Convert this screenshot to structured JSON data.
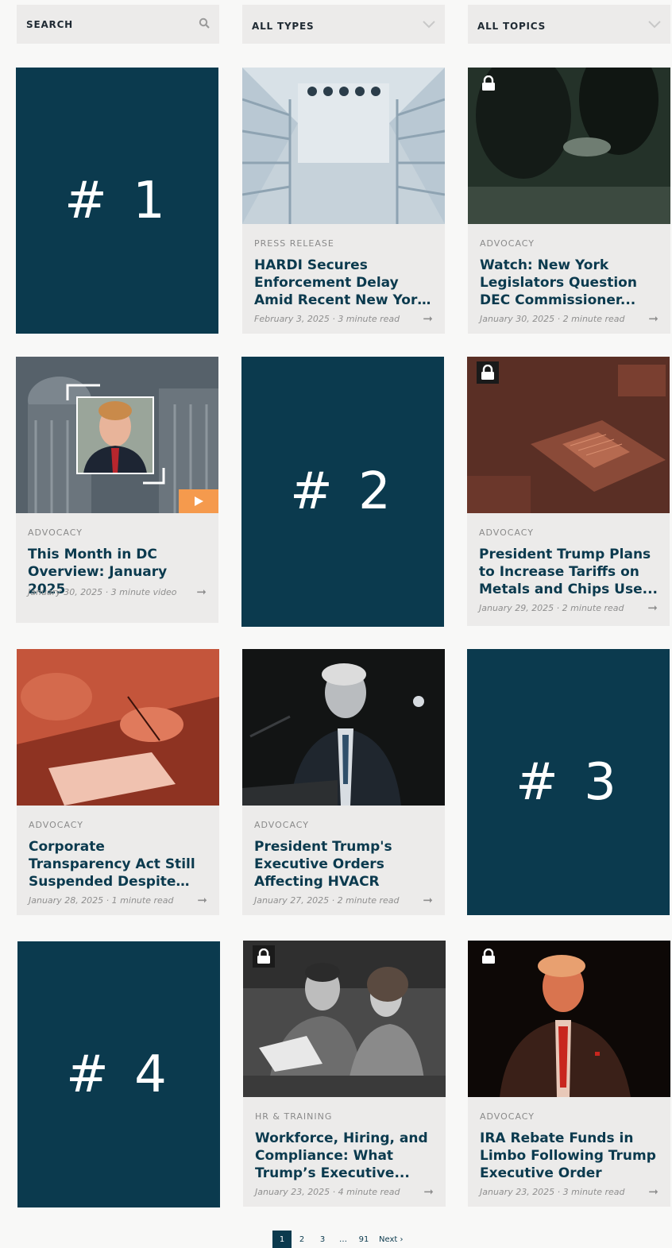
{
  "filters": {
    "search": "SEARCH",
    "types": "ALL TYPES",
    "topics": "ALL TOPICS"
  },
  "ranks": [
    "# 1",
    "# 2",
    "# 3",
    "# 4"
  ],
  "cards": [
    {
      "category": "PRESS RELEASE",
      "title": "HARDI Secures Enforcement Delay Amid Recent New York DEC...",
      "meta": "February 3, 2025 · 3 minute read",
      "locked": false
    },
    {
      "category": "ADVOCACY",
      "title": "Watch: New York Legislators Question DEC Commissioner...",
      "meta": "January 30, 2025 · 2 minute read",
      "locked": true
    },
    {
      "category": "ADVOCACY",
      "title": "This Month in DC Overview: January 2025",
      "meta": "January 30, 2025 · 3 minute video",
      "locked": false
    },
    {
      "category": "ADVOCACY",
      "title": "President Trump Plans to Increase Tariffs on Metals and Chips Use...",
      "meta": "January 29, 2025 · 2 minute read",
      "locked": true
    },
    {
      "category": "ADVOCACY",
      "title": "Corporate Transparency Act Still Suspended Despite Supreme Cour...",
      "meta": "January 28, 2025 · 1 minute read",
      "locked": false
    },
    {
      "category": "ADVOCACY",
      "title": "President Trump's Executive Orders Affecting HVACR",
      "meta": "January 27, 2025 · 2 minute read",
      "locked": false
    },
    {
      "category": "HR & TRAINING",
      "title": "Workforce, Hiring, and Compliance: What Trump’s Executive...",
      "meta": "January 23, 2025 · 4 minute read",
      "locked": true
    },
    {
      "category": "ADVOCACY",
      "title": "IRA Rebate Funds in Limbo Following Trump Executive Order",
      "meta": "January 23, 2025 · 3 minute read",
      "locked": true
    }
  ],
  "pagination": {
    "pages": [
      "1",
      "2",
      "3",
      "…",
      "91"
    ],
    "current": "1",
    "next": "Next ›"
  },
  "colors": {
    "navy": "#0b3a4e",
    "card_bg": "#ecebea",
    "orange": "#f59a4d",
    "rust": "#c4553b"
  }
}
